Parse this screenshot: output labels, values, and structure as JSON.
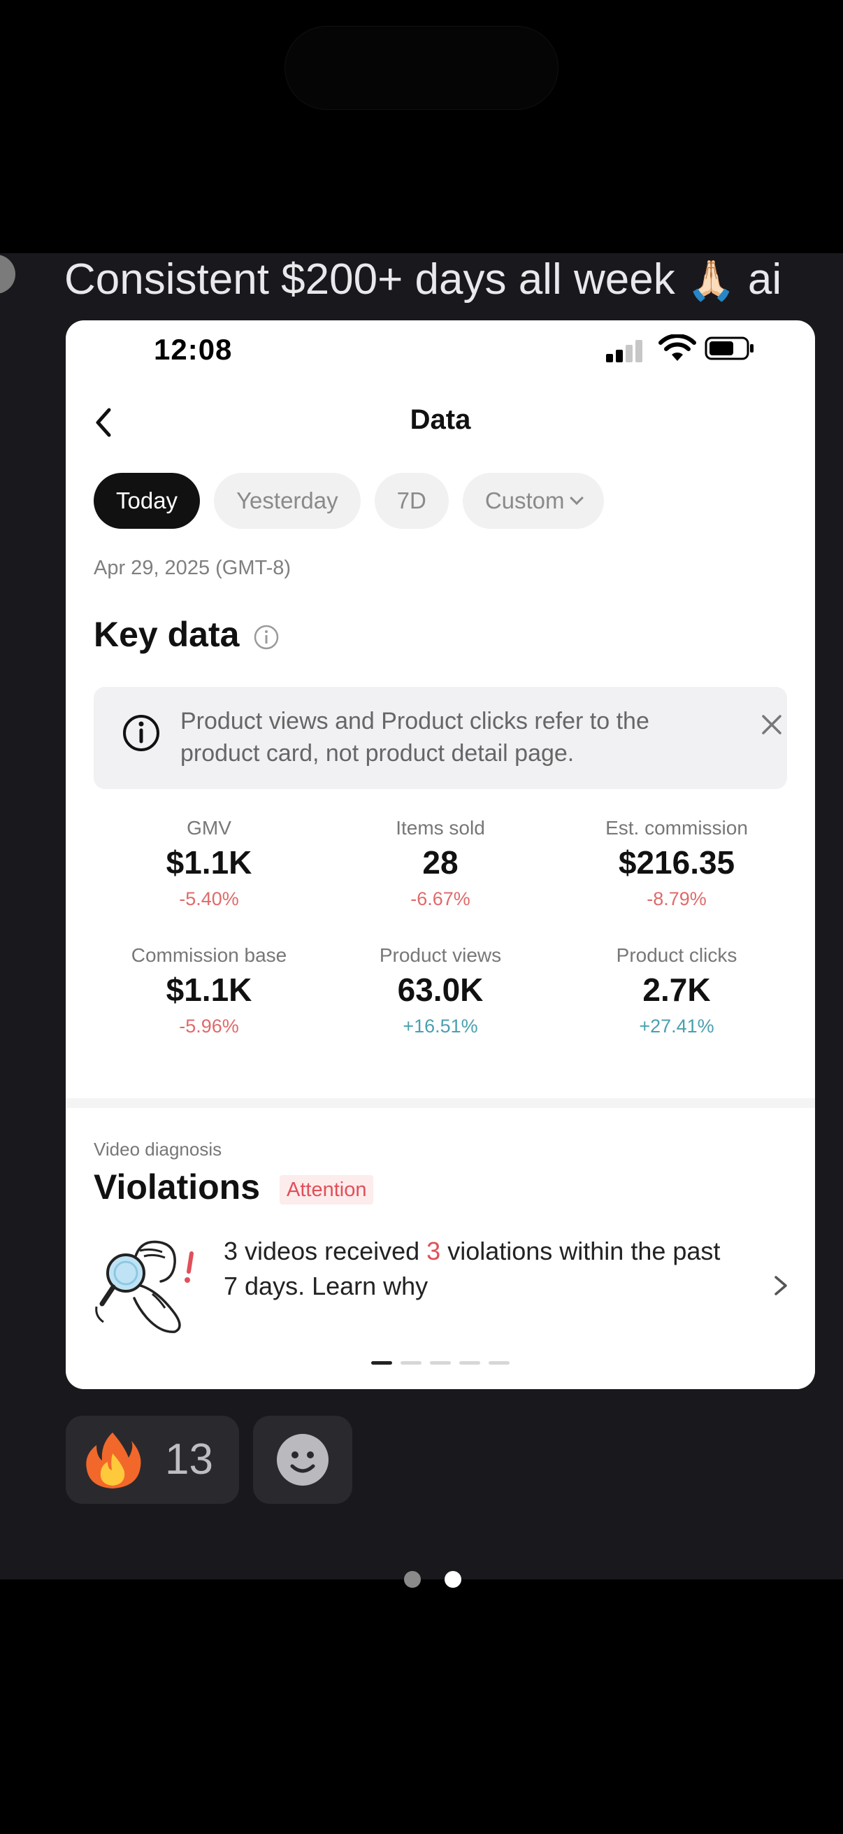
{
  "caption": {
    "text": "Consistent $200+ days all week ",
    "emoji": "🙏🏻",
    "trailing": " ai"
  },
  "status_bar": {
    "time": "12:08"
  },
  "nav": {
    "title": "Data"
  },
  "chips": [
    {
      "label": "Today",
      "active": true
    },
    {
      "label": "Yesterday",
      "active": false
    },
    {
      "label": "7D",
      "active": false
    },
    {
      "label": "Custom",
      "active": false
    }
  ],
  "date_label": "Apr 29, 2025 (GMT-8)",
  "key_data": {
    "title": "Key data",
    "notice": "Product views and Product clicks refer to the product card, not product detail page."
  },
  "metrics": [
    {
      "label": "GMV",
      "value": "$1.1K",
      "change": "-5.40%",
      "trend": "down"
    },
    {
      "label": "Items sold",
      "value": "28",
      "change": "-6.67%",
      "trend": "down"
    },
    {
      "label": "Est. commission",
      "value": "$216.35",
      "change": "-8.79%",
      "trend": "down"
    },
    {
      "label": "Commission base",
      "value": "$1.1K",
      "change": "-5.96%",
      "trend": "down"
    },
    {
      "label": "Product views",
      "value": "63.0K",
      "change": "+16.51%",
      "trend": "up"
    },
    {
      "label": "Product clicks",
      "value": "2.7K",
      "change": "+27.41%",
      "trend": "up"
    }
  ],
  "video_diagnosis": {
    "subtitle": "Video diagnosis",
    "title": "Violations",
    "badge": "Attention",
    "message_prefix": "3 videos received ",
    "message_count": "3",
    "message_suffix": " violations within the past 7 days. Learn why"
  },
  "carousel": {
    "page_count": 5,
    "active_index": 0
  },
  "reactions": [
    {
      "icon": "fire-icon",
      "count": "13"
    },
    {
      "icon": "smile-add-icon",
      "count": ""
    }
  ],
  "colors": {
    "negative": "#e06a6a",
    "positive": "#4aa0b0",
    "attention": "#e0505a",
    "chat_background": "#19181c"
  }
}
